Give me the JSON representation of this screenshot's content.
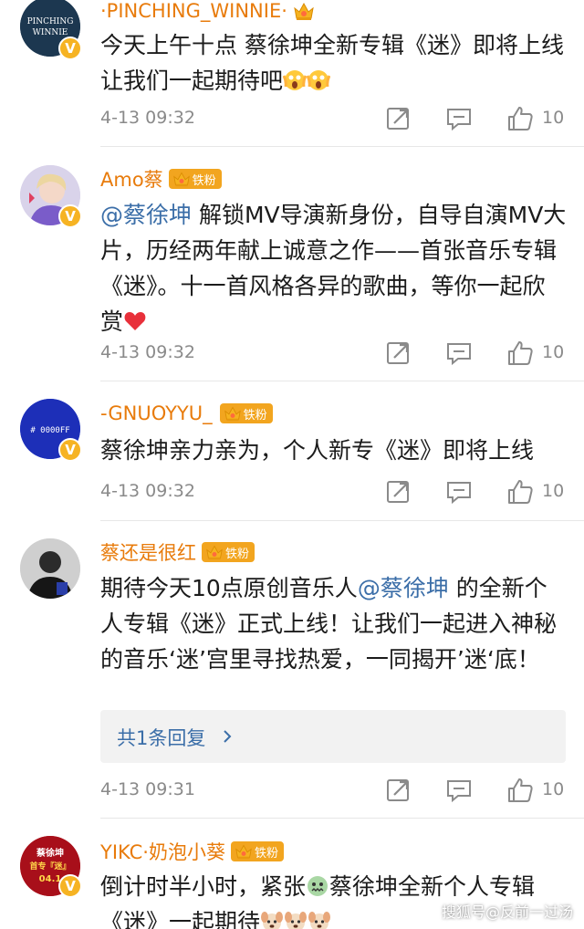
{
  "comments": [
    {
      "username": "·PINCHING_WINNIE·",
      "avatar_text": "PINCHING\nWINNIE",
      "text": "今天上午十点 蔡徐坤全新专辑《迷》即将上线 让我们一起期待吧",
      "time": "4-13 09:32",
      "likes": "10"
    },
    {
      "username": "Amo蔡",
      "fan_tag": "铁粉",
      "mention": "@蔡徐坤",
      "text": " 解锁MV导演新身份，自导自演MV大片，历经两年献上诚意之作——首张音乐专辑《迷》。十一首风格各异的歌曲，等你一起欣赏",
      "time": "4-13 09:32",
      "likes": "10"
    },
    {
      "username": "-GNUOYYU_",
      "fan_tag": "铁粉",
      "avatar_text": "# 0000FF",
      "text": "蔡徐坤亲力亲为，个人新专《迷》即将上线",
      "time": "4-13 09:32",
      "likes": "10"
    },
    {
      "username": "蔡还是很红",
      "fan_tag": "铁粉",
      "text_before": "期待今天10点原创音乐人",
      "mention": "@蔡徐坤",
      "text_after": " 的全新个人专辑《迷》正式上线！让我们一起进入神秘的音乐‘迷’宫里寻找热爱，一同揭开’迷‘底！",
      "reply_label": "共1条回复",
      "time": "4-13 09:31",
      "likes": "10"
    },
    {
      "username": "YIKC·奶泡小葵",
      "fan_tag": "铁粉",
      "avatar_text": "蔡徐坤\n首专『迷』\n04.1",
      "text_before": "倒计时半小时，紧张",
      "text_after": "蔡徐坤全新个人专辑《迷》一起期待"
    }
  ],
  "watermark": "搜狐号@反前一过汤",
  "colors": {
    "username": "#e87b0b",
    "mention": "#3b6ea8",
    "meta": "#8a8a8a",
    "fan_tag": "#f2a51f",
    "verified": "#f6b323"
  },
  "icons": [
    "share-icon",
    "comment-icon",
    "like-icon",
    "crown-icon",
    "verified-icon",
    "heart-emoji",
    "scream-emoji",
    "dog-emoji",
    "nervous-emoji",
    "chevron-right-icon"
  ]
}
